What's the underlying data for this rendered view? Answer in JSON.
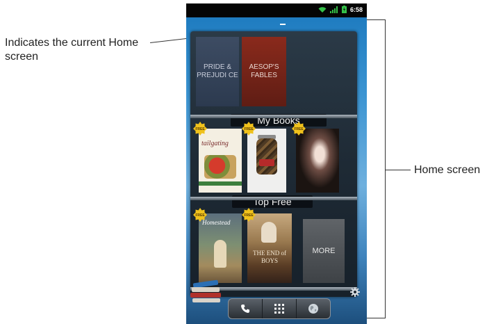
{
  "annotations": {
    "current_home_indicator": "Indicates the current Home screen",
    "home_screen": "Home screen"
  },
  "status_bar": {
    "time": "6:58",
    "icons": [
      "wifi-icon",
      "signal-icon",
      "battery-icon"
    ]
  },
  "bookshelf": {
    "shelves": [
      {
        "label": "My Books",
        "books": [
          {
            "title": "PRIDE & PREJUDI CE"
          },
          {
            "title": "AESOP'S FABLES"
          }
        ]
      },
      {
        "label": "Top Free",
        "badge": "FREE",
        "books": [
          {
            "cover_title": "tailgating"
          },
          {
            "cover_title": ""
          },
          {
            "cover_title": ""
          }
        ]
      },
      {
        "label": "",
        "badge": "FREE",
        "books": [
          {
            "cover_title": "Homestead"
          },
          {
            "cover_title": "THE END of BOYS"
          },
          {
            "title": "MORE"
          }
        ]
      }
    ]
  },
  "dock": {
    "items": [
      "phone-icon",
      "app-grid-icon",
      "browser-globe-icon"
    ]
  },
  "colors": {
    "wallpaper_top": "#1f7cc0",
    "wallpaper_bottom": "#1d4f7d",
    "free_badge": "#f0c21c"
  }
}
